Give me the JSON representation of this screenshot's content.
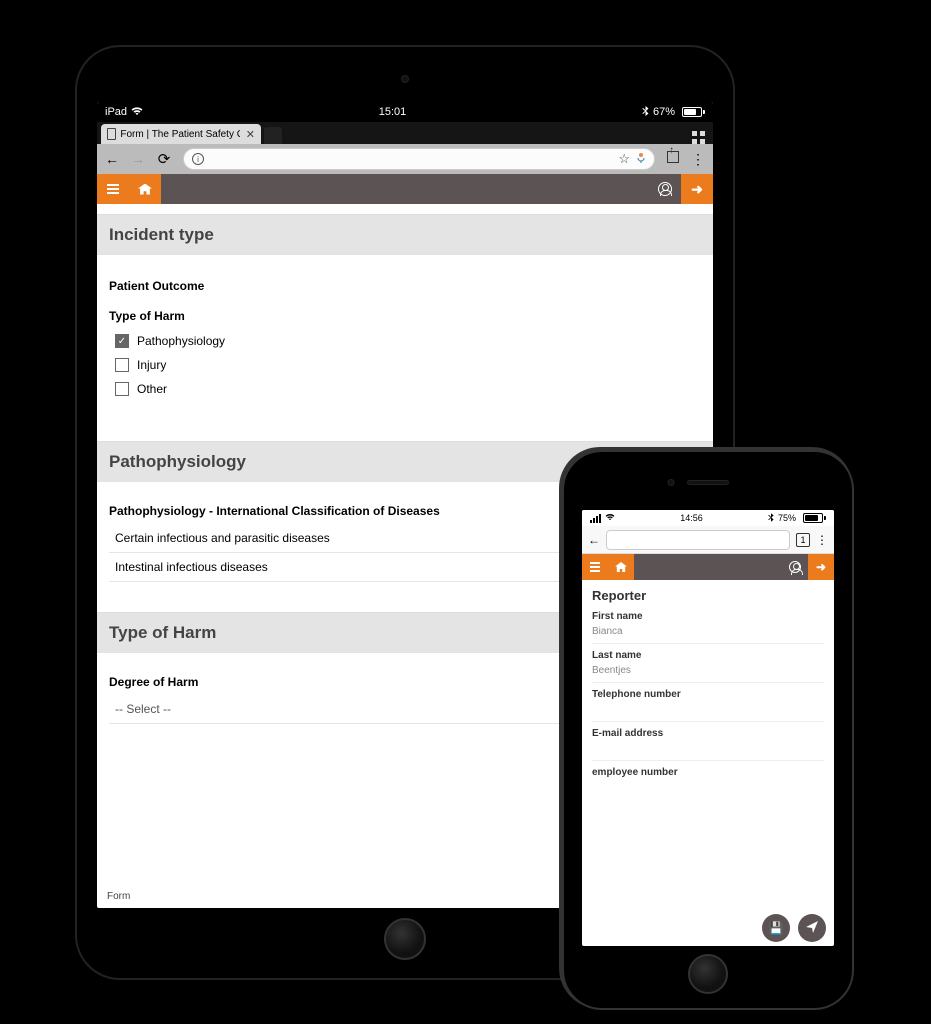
{
  "ipad": {
    "status": {
      "carrier": "iPad",
      "time": "15:01",
      "battery_pct": "67%",
      "battery_level": 67
    },
    "browser": {
      "tab_title": "Form | The Patient Safety Co",
      "tab_count_icon": "1"
    },
    "app": {
      "accent": "#EB7B1C"
    },
    "form": {
      "section_incident_type": "Incident type",
      "patient_outcome_label": "Patient Outcome",
      "type_of_harm_label": "Type of Harm",
      "harm_options": [
        {
          "label": "Pathophysiology",
          "checked": true
        },
        {
          "label": "Injury",
          "checked": false
        },
        {
          "label": "Other",
          "checked": false
        }
      ],
      "section_pathophysiology": "Pathophysiology",
      "classification_label": "Pathophysiology - International Classification of Diseases",
      "classification_items": [
        "Certain infectious and parasitic diseases",
        "Intestinal infectious diseases"
      ],
      "section_type_of_harm": "Type of Harm",
      "degree_of_harm_label": "Degree of Harm",
      "degree_of_harm_placeholder": "-- Select --",
      "footer": "Form"
    }
  },
  "iphone": {
    "status": {
      "time": "14:56",
      "battery_pct": "75%",
      "battery_level": 75
    },
    "browser": {
      "tab_count": "1"
    },
    "form": {
      "section_reporter": "Reporter",
      "fields": {
        "first_name_label": "First name",
        "first_name_value": "Bianca",
        "last_name_label": "Last name",
        "last_name_value": "Beentjes",
        "telephone_label": "Telephone number",
        "telephone_value": "",
        "email_label": "E-mail address",
        "email_value": "",
        "employee_label": "employee number",
        "employee_value": ""
      }
    }
  }
}
